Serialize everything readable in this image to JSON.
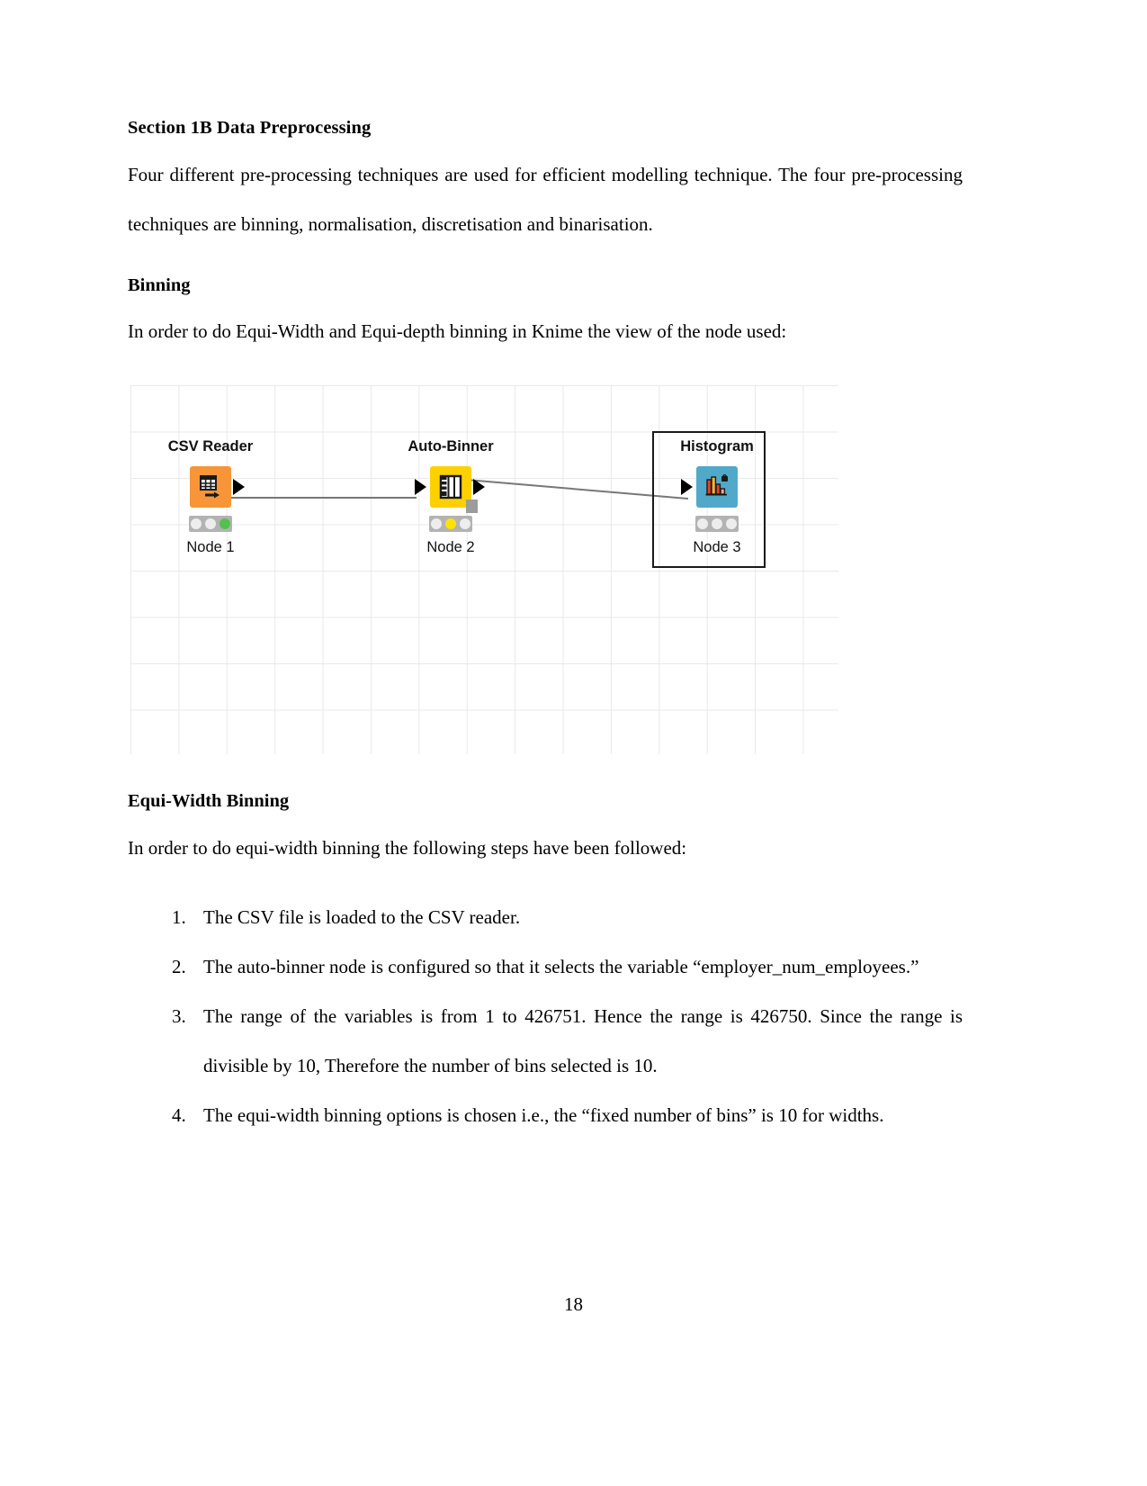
{
  "document": {
    "section_heading": "Section 1B Data Preprocessing",
    "intro_paragraph": "Four different pre-processing techniques are used for efficient modelling technique. The four pre-processing techniques are binning, normalisation, discretisation and binarisation.",
    "binning_heading": "Binning",
    "binning_intro": "In order to do Equi-Width and Equi-depth binning in Knime the view of the node used:",
    "equi_width_heading": "Equi-Width Binning",
    "equi_width_intro": "In order to do equi-width binning the following steps have been followed:",
    "steps": [
      "The CSV file is loaded to the CSV reader.",
      "The auto-binner node is configured so that it selects the variable “employer_num_employees.”",
      "The range of the variables is from 1 to 426751. Hence the range is 426750. Since the range is divisible by 10, Therefore the number of bins selected is 10.",
      "The equi-width binning options is chosen i.e., the “fixed number of bins” is 10 for widths."
    ],
    "page_number": "18"
  },
  "workflow": {
    "nodes": [
      {
        "title": "CSV Reader",
        "label": "Node 1",
        "icon": "csv-table-arrow-icon",
        "icon_color": "#f79538",
        "status": "executed",
        "status_lamp": "green",
        "selected": false
      },
      {
        "title": "Auto-Binner",
        "label": "Node 2",
        "icon": "binner-columns-icon",
        "icon_color": "#fdd000",
        "status": "configured",
        "status_lamp": "yellow",
        "selected": false
      },
      {
        "title": "Histogram",
        "label": "Node 3",
        "icon": "histogram-bars-icon",
        "icon_color": "#50a9c8",
        "status": "warning",
        "status_lamp": "warning",
        "selected": true
      }
    ],
    "connections": [
      {
        "from": "Node 1",
        "to": "Node 2"
      },
      {
        "from": "Node 2",
        "to": "Node 3"
      }
    ],
    "grid_color": "#e9e9e9",
    "warning_color": "#ffd21e"
  }
}
